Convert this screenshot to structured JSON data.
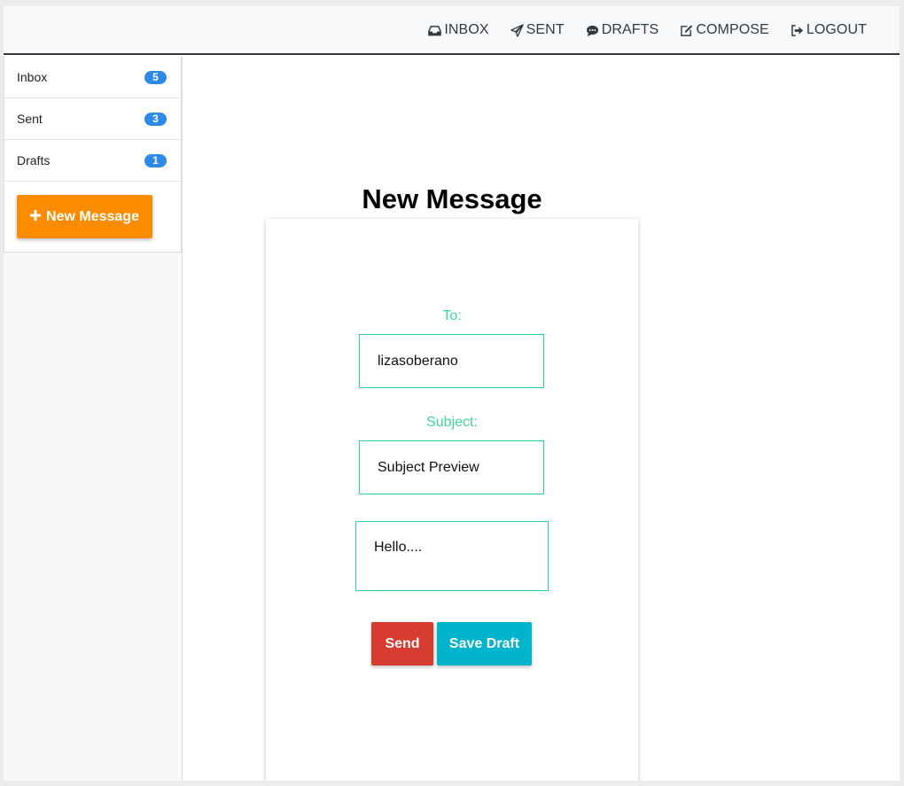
{
  "nav": {
    "items": [
      {
        "label": "INBOX",
        "icon": "inbox-icon"
      },
      {
        "label": "SENT",
        "icon": "paper-plane-icon"
      },
      {
        "label": "DRAFTS",
        "icon": "comment-icon"
      },
      {
        "label": "COMPOSE",
        "icon": "edit-icon"
      },
      {
        "label": "LOGOUT",
        "icon": "sign-out-icon"
      }
    ]
  },
  "sidebar": {
    "items": [
      {
        "label": "Inbox",
        "count": "5"
      },
      {
        "label": "Sent",
        "count": "3"
      },
      {
        "label": "Drafts",
        "count": "1"
      }
    ],
    "new_message_label": "New Message"
  },
  "compose": {
    "title": "New Message",
    "to_label": "To:",
    "to_value": "lizasoberano",
    "subject_label": "Subject:",
    "subject_value": "Subject Preview",
    "body_value": "Hello....",
    "send_label": "Send",
    "save_draft_label": "Save Draft"
  },
  "colors": {
    "accent_orange": "#fb8c00",
    "badge_blue": "#2e8ae6",
    "label_green": "#3dd598",
    "input_border": "#29d0b4",
    "send_red": "#d63c2f",
    "draft_cyan": "#00b4cc"
  }
}
